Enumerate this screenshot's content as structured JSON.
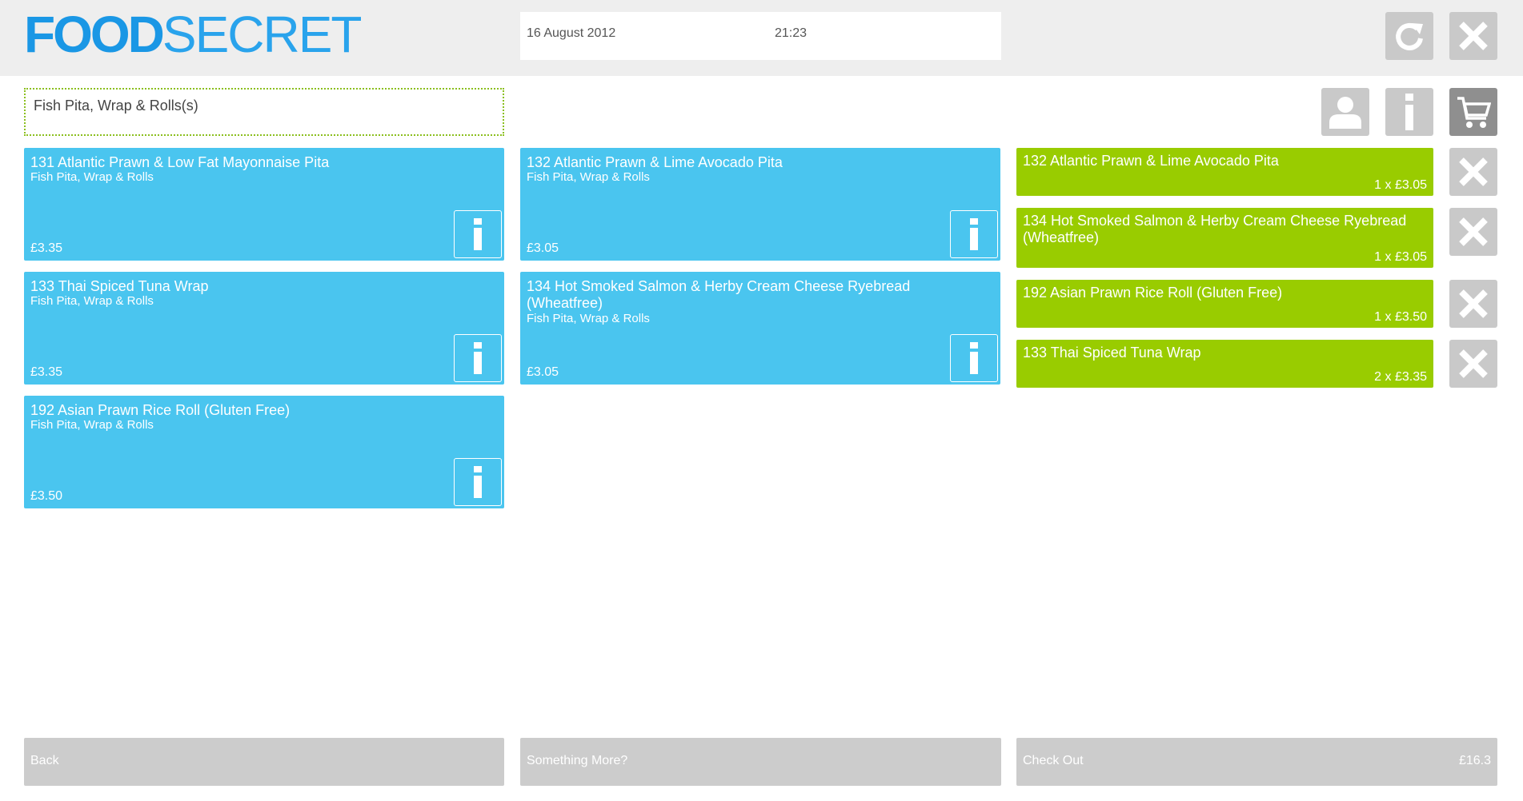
{
  "app": {
    "logo_part1": "FOOD",
    "logo_part2": "SECRET",
    "date": "16 August 2012",
    "time": "21:23"
  },
  "toolbar": {
    "refresh_icon": "refresh-icon",
    "close_icon": "close-icon",
    "user_icon": "user-icon",
    "info_icon": "info-icon",
    "cart_icon": "cart-icon"
  },
  "category": {
    "label": "Fish Pita, Wrap & Rolls(s)"
  },
  "products": [
    {
      "title": "131 Atlantic Prawn & Low Fat Mayonnaise Pita",
      "category": "Fish Pita, Wrap & Rolls",
      "price": "£3.35"
    },
    {
      "title": "132 Atlantic Prawn & Lime Avocado Pita",
      "category": "Fish Pita, Wrap & Rolls",
      "price": "£3.05"
    },
    {
      "title": "133 Thai Spiced Tuna Wrap",
      "category": "Fish Pita, Wrap & Rolls",
      "price": "£3.35"
    },
    {
      "title": "134 Hot Smoked Salmon & Herby Cream Cheese Ryebread (Wheatfree)",
      "category": "Fish Pita, Wrap & Rolls",
      "price": "£3.05"
    },
    {
      "title": "192 Asian Prawn Rice Roll (Gluten Free)",
      "category": "Fish Pita, Wrap & Rolls",
      "price": "£3.50"
    }
  ],
  "basket": [
    {
      "title": "132 Atlantic Prawn & Lime Avocado Pita",
      "qty": "1 x £3.05"
    },
    {
      "title": "134 Hot Smoked Salmon & Herby Cream Cheese Ryebread (Wheatfree)",
      "qty": "1 x £3.05"
    },
    {
      "title": "192 Asian Prawn Rice Roll (Gluten Free)",
      "qty": "1 x £3.50"
    },
    {
      "title": "133 Thai Spiced Tuna Wrap",
      "qty": "2 x £3.35"
    }
  ],
  "footer": {
    "back": "Back",
    "more": "Something More?",
    "checkout": "Check Out",
    "total": "£16.3"
  },
  "colors": {
    "brand_blue": "#1a97e5",
    "card_blue": "#4ac5ef",
    "basket_green": "#99cc00",
    "button_grey": "#c9c9c9"
  }
}
